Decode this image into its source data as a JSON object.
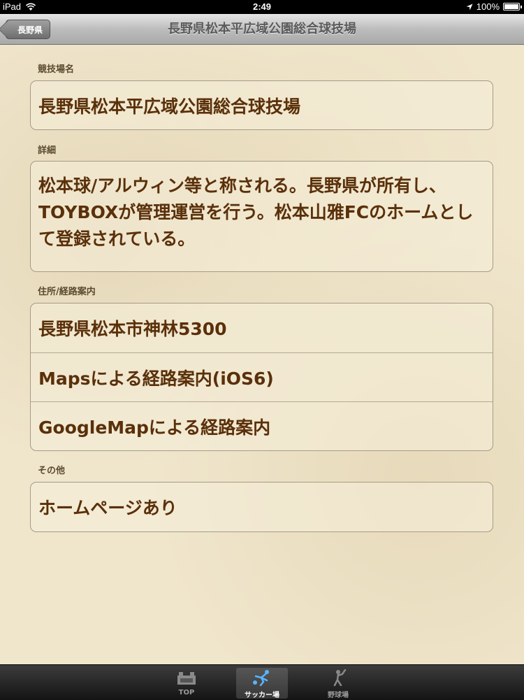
{
  "status_bar": {
    "device": "iPad",
    "time": "2:49",
    "battery_text": "100%",
    "battery_level": 1.0
  },
  "nav": {
    "back_label": "長野県",
    "title": "長野県松本平広域公園総合球技場"
  },
  "sections": {
    "name": {
      "header": "競技場名",
      "value": "長野県松本平広域公園総合球技場"
    },
    "detail": {
      "header": "詳細",
      "value": "松本球/アルウィン等と称される。長野県が所有し、TOYBOXが管理運営を行う。松本山雅FCのホームとして登録されている。"
    },
    "address": {
      "header": "住所/経路案内",
      "rows": [
        {
          "label": "長野県松本市神林5300"
        },
        {
          "label": "Mapsによる経路案内(iOS6)"
        },
        {
          "label": "GoogleMapによる経路案内"
        }
      ]
    },
    "other": {
      "header": "その他",
      "value": "ホームページあり"
    }
  },
  "tabbar": {
    "tabs": [
      {
        "label": "TOP",
        "icon": "stadium-icon",
        "active": false
      },
      {
        "label": "サッカー場",
        "icon": "soccer-player-icon",
        "active": true
      },
      {
        "label": "野球場",
        "icon": "baseball-player-icon",
        "active": false
      }
    ]
  },
  "colors": {
    "accent_text": "#5a300a",
    "background": "#f0e6cc"
  }
}
